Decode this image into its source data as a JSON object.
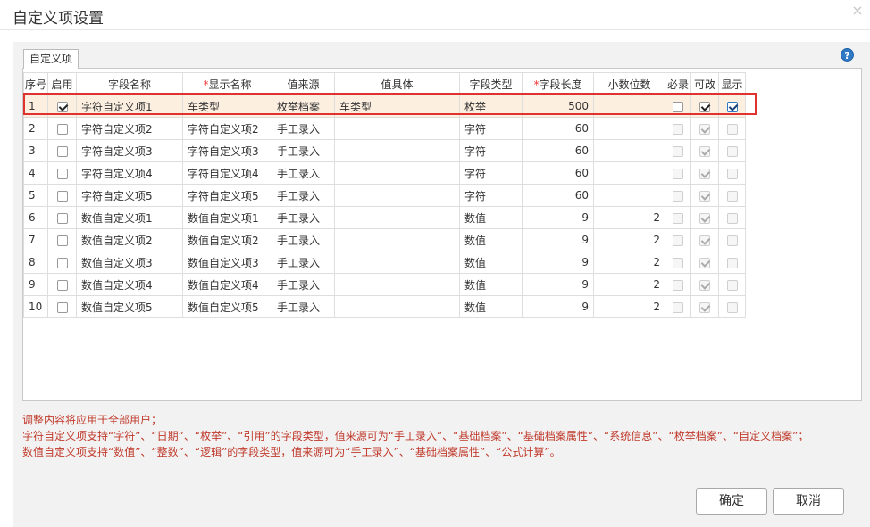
{
  "dialog": {
    "title": "自定义项设置",
    "close_glyph": "×",
    "help_glyph": "?"
  },
  "tab": {
    "label": "自定义项"
  },
  "columns": [
    {
      "label": "序号",
      "required": false
    },
    {
      "label": "启用",
      "required": false
    },
    {
      "label": "字段名称",
      "required": false
    },
    {
      "label": "显示名称",
      "required": true
    },
    {
      "label": "值来源",
      "required": false
    },
    {
      "label": "值具体",
      "required": false
    },
    {
      "label": "字段类型",
      "required": false
    },
    {
      "label": "字段长度",
      "required": true
    },
    {
      "label": "小数位数",
      "required": false
    },
    {
      "label": "必录",
      "required": false
    },
    {
      "label": "可改",
      "required": false
    },
    {
      "label": "显示",
      "required": false
    }
  ],
  "required_mark": "*",
  "rows": [
    {
      "seq": "1",
      "enabled": true,
      "field": "字符自定义项1",
      "display": "车类型",
      "source": "枚举档案",
      "detail": "车类型",
      "type": "枚举",
      "length": "500",
      "decimals": "",
      "required": false,
      "editable": true,
      "visible": true,
      "selected": true
    },
    {
      "seq": "2",
      "enabled": false,
      "field": "字符自定义项2",
      "display": "字符自定义项2",
      "source": "手工录入",
      "detail": "",
      "type": "字符",
      "length": "60",
      "decimals": "",
      "required": false,
      "editable": true,
      "visible": false,
      "selected": false
    },
    {
      "seq": "3",
      "enabled": false,
      "field": "字符自定义项3",
      "display": "字符自定义项3",
      "source": "手工录入",
      "detail": "",
      "type": "字符",
      "length": "60",
      "decimals": "",
      "required": false,
      "editable": true,
      "visible": false,
      "selected": false
    },
    {
      "seq": "4",
      "enabled": false,
      "field": "字符自定义项4",
      "display": "字符自定义项4",
      "source": "手工录入",
      "detail": "",
      "type": "字符",
      "length": "60",
      "decimals": "",
      "required": false,
      "editable": true,
      "visible": false,
      "selected": false
    },
    {
      "seq": "5",
      "enabled": false,
      "field": "字符自定义项5",
      "display": "字符自定义项5",
      "source": "手工录入",
      "detail": "",
      "type": "字符",
      "length": "60",
      "decimals": "",
      "required": false,
      "editable": true,
      "visible": false,
      "selected": false
    },
    {
      "seq": "6",
      "enabled": false,
      "field": "数值自定义项1",
      "display": "数值自定义项1",
      "source": "手工录入",
      "detail": "",
      "type": "数值",
      "length": "9",
      "decimals": "2",
      "required": false,
      "editable": true,
      "visible": false,
      "selected": false
    },
    {
      "seq": "7",
      "enabled": false,
      "field": "数值自定义项2",
      "display": "数值自定义项2",
      "source": "手工录入",
      "detail": "",
      "type": "数值",
      "length": "9",
      "decimals": "2",
      "required": false,
      "editable": true,
      "visible": false,
      "selected": false
    },
    {
      "seq": "8",
      "enabled": false,
      "field": "数值自定义项3",
      "display": "数值自定义项3",
      "source": "手工录入",
      "detail": "",
      "type": "数值",
      "length": "9",
      "decimals": "2",
      "required": false,
      "editable": true,
      "visible": false,
      "selected": false
    },
    {
      "seq": "9",
      "enabled": false,
      "field": "数值自定义项4",
      "display": "数值自定义项4",
      "source": "手工录入",
      "detail": "",
      "type": "数值",
      "length": "9",
      "decimals": "2",
      "required": false,
      "editable": true,
      "visible": false,
      "selected": false
    },
    {
      "seq": "10",
      "enabled": false,
      "field": "数值自定义项5",
      "display": "数值自定义项5",
      "source": "手工录入",
      "detail": "",
      "type": "数值",
      "length": "9",
      "decimals": "2",
      "required": false,
      "editable": true,
      "visible": false,
      "selected": false
    }
  ],
  "notes": [
    "调整内容将应用于全部用户；",
    "字符自定义项支持“字符”、“日期”、“枚举”、“引用”的字段类型，值来源可为“手工录入”、“基础档案”、“基础档案属性”、“系统信息”、“枚举档案”、“自定义档案”；",
    "数值自定义项支持“数值”、“整数”、“逻辑”的字段类型，值来源可为“手工录入”、“基础档案属性”、“公式计算”。"
  ],
  "buttons": {
    "ok": "确定",
    "cancel": "取消"
  },
  "colors": {
    "note_text": "#c0392b",
    "highlight_border": "#e0322f",
    "selected_row": "#fcefe0",
    "help_icon": "#2f79c5"
  }
}
